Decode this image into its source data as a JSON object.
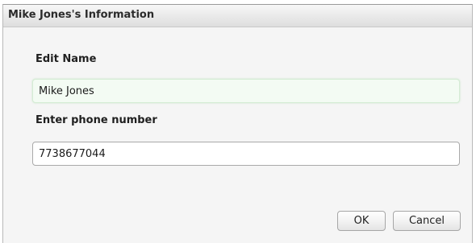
{
  "dialog": {
    "title": "Mike Jones's Information",
    "name_label": "Edit Name",
    "name_value": "Mike Jones",
    "phone_label": "Enter phone number",
    "phone_value": "7738677044",
    "ok_label": "OK",
    "cancel_label": "Cancel"
  }
}
